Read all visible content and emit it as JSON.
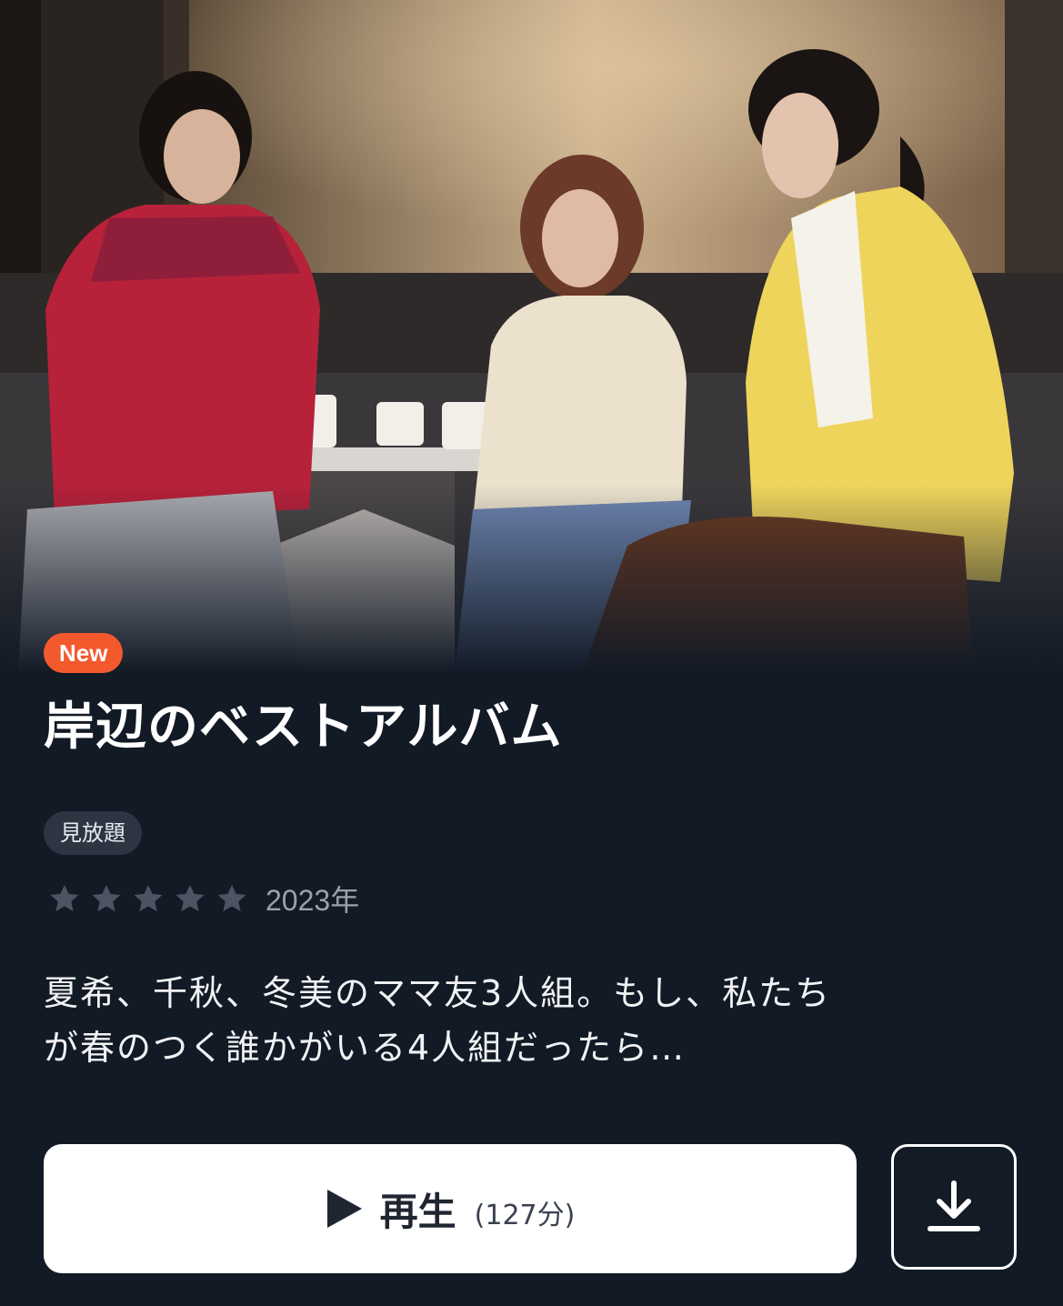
{
  "badge": {
    "label": "New",
    "color": "#f25a2e"
  },
  "title": "岸辺のベストアルバム",
  "plan_tag": "見放題",
  "rating": {
    "stars_total": 5,
    "stars_filled": 0,
    "year": "2023年"
  },
  "synopsis": {
    "line1": "夏希、千秋、冬美のママ友3人組。もし、私たち",
    "line2": "が春のつく誰かがいる4人組だったら…"
  },
  "play_button": {
    "label": "再生",
    "duration": "(127分)",
    "icon": "play-icon"
  },
  "download_button": {
    "icon": "download-icon"
  },
  "colors": {
    "background": "#121a26",
    "accent": "#f25a2e"
  }
}
